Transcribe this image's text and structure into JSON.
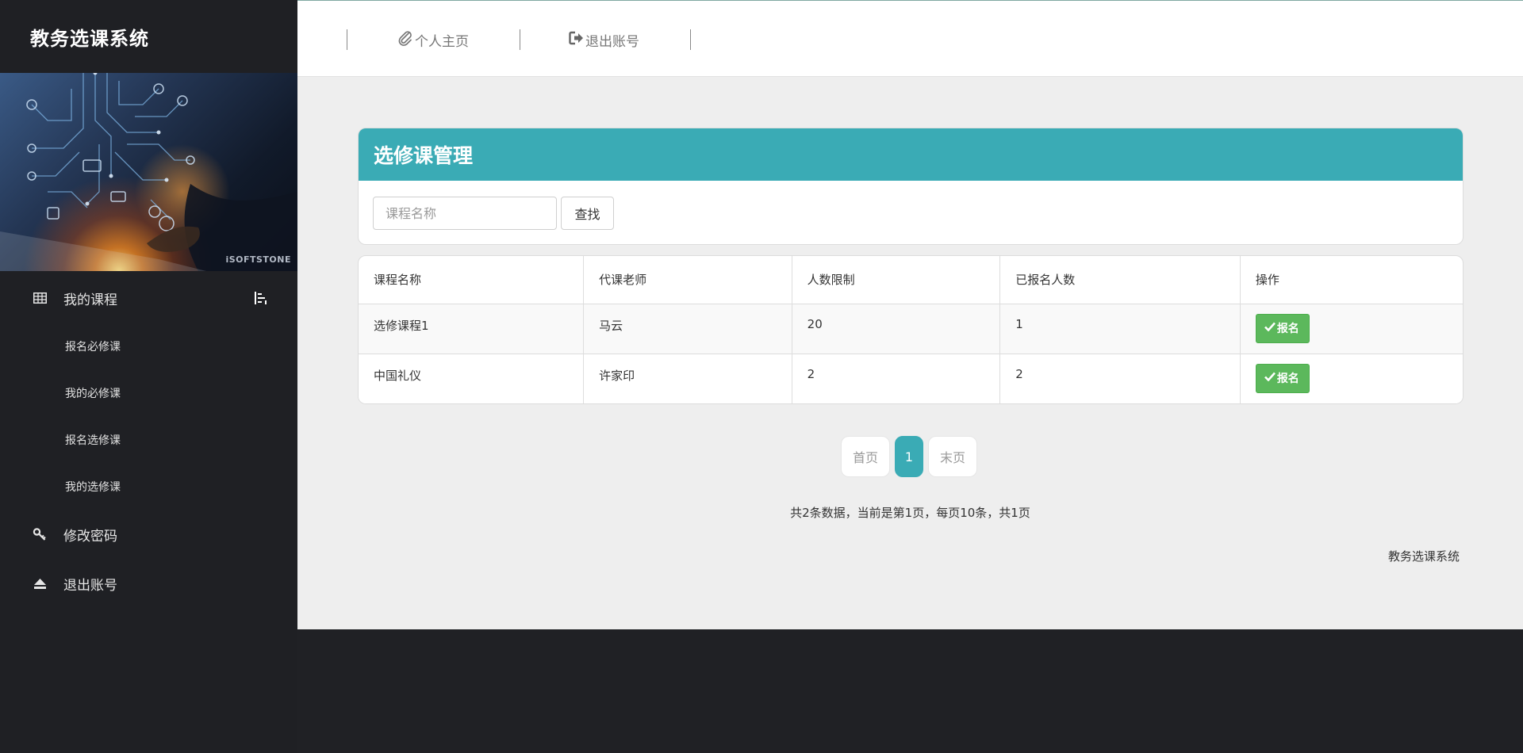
{
  "app": {
    "title": "教务选课系统",
    "banner_watermark": "iSOFTSTONE"
  },
  "sidebar": {
    "my_courses": "我的课程",
    "sub_items": [
      "报名必修课",
      "我的必修课",
      "报名选修课",
      "我的选修课"
    ],
    "change_password": "修改密码",
    "logout": "退出账号"
  },
  "topbar": {
    "profile": "个人主页",
    "logout": "退出账号"
  },
  "panel": {
    "title": "选修课管理",
    "search_placeholder": "课程名称",
    "search_button": "查找"
  },
  "table": {
    "headers": [
      "课程名称",
      "代课老师",
      "人数限制",
      "已报名人数",
      "操作"
    ],
    "rows": [
      {
        "name": "选修课程1",
        "teacher": "马云",
        "limit": "20",
        "enrolled": "1",
        "action": "报名"
      },
      {
        "name": "中国礼仪",
        "teacher": "许家印",
        "limit": "2",
        "enrolled": "2",
        "action": "报名"
      }
    ]
  },
  "pagination": {
    "first": "首页",
    "current": "1",
    "last": "末页"
  },
  "summary": "共2条数据，当前是第1页，每页10条，共1页",
  "footer": "教务选课系统",
  "colors": {
    "accent": "#3aabb5",
    "success": "#5cb85c",
    "sidebar_bg": "#1f2024"
  },
  "icons": {
    "my_courses": "table-icon",
    "toggle": "menu-toggle-icon",
    "change_password": "key-icon",
    "logout": "eject-icon",
    "profile": "paperclip-icon",
    "topbar_logout": "logout-icon",
    "enroll": "check-icon"
  }
}
